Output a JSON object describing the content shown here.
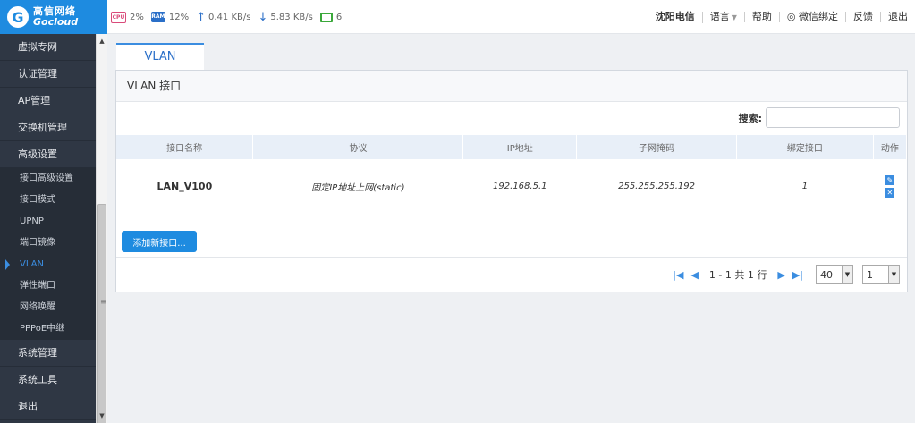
{
  "logo": {
    "cn": "高信网络",
    "en": "Gocloud"
  },
  "status": {
    "cpu_chip": "CPU",
    "cpu": "2%",
    "ram_chip": "RAM",
    "ram": "12%",
    "up": "0.41 KB/s",
    "down": "5.83 KB/s",
    "devices": "6"
  },
  "topnav": {
    "isp": "沈阳电信",
    "language": "语言",
    "help": "帮助",
    "wechat": "微信绑定",
    "feedback": "反馈",
    "logout": "退出"
  },
  "sidebar": {
    "main_top": [
      "虚拟专网",
      "认证管理",
      "AP管理",
      "交换机管理",
      "高级设置"
    ],
    "sub": [
      "接口高级设置",
      "接口模式",
      "UPNP",
      "端口镜像",
      "VLAN",
      "弹性端口",
      "网络唤醒",
      "PPPoE中继"
    ],
    "main_bottom": [
      "系统管理",
      "系统工具",
      "退出"
    ]
  },
  "tab": {
    "label": "VLAN"
  },
  "panel": {
    "title": "VLAN 接口",
    "search_label": "搜索:",
    "search_value": "",
    "columns": [
      "接口名称",
      "协议",
      "IP地址",
      "子网掩码",
      "绑定接口",
      "动作"
    ],
    "rows": [
      {
        "name": "LAN_V100",
        "protocol": "固定IP地址上网(static)",
        "ip": "192.168.5.1",
        "mask": "255.255.255.192",
        "bind": "1"
      }
    ],
    "add_label": "添加新接口..."
  },
  "pager": {
    "info": "1 - 1 共 1 行",
    "page_size": "40",
    "page": "1"
  },
  "colors": {
    "accent": "#1e8be0",
    "sidebar": "#2f3744"
  }
}
